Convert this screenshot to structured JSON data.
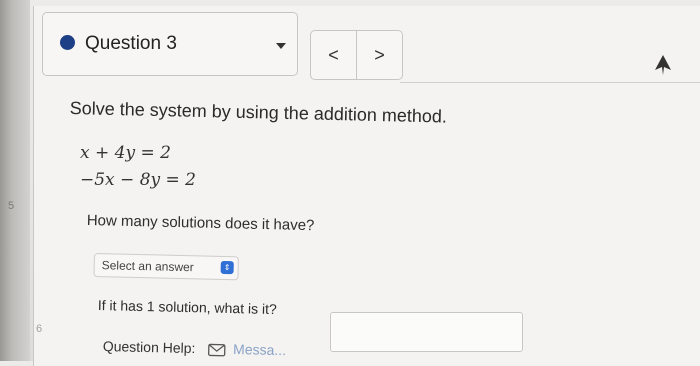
{
  "gutter": {
    "line_5": "5",
    "line_6": "6"
  },
  "question_nav": {
    "label": "Question 3",
    "prev_glyph": "<",
    "next_glyph": ">"
  },
  "problem": {
    "instruction": "Solve the system by using the addition method.",
    "equation_1": "x + 4y = 2",
    "equation_2": "−5x − 8y = 2",
    "question_1": "How many solutions does it have?",
    "select_placeholder": "Select an answer",
    "question_2": "If it has 1 solution, what is it?",
    "answer_value": "",
    "help_label": "Question Help:",
    "help_link": "Messa..."
  },
  "colors": {
    "dot": "#1d3f86",
    "select_icon": "#2f6fd6"
  }
}
